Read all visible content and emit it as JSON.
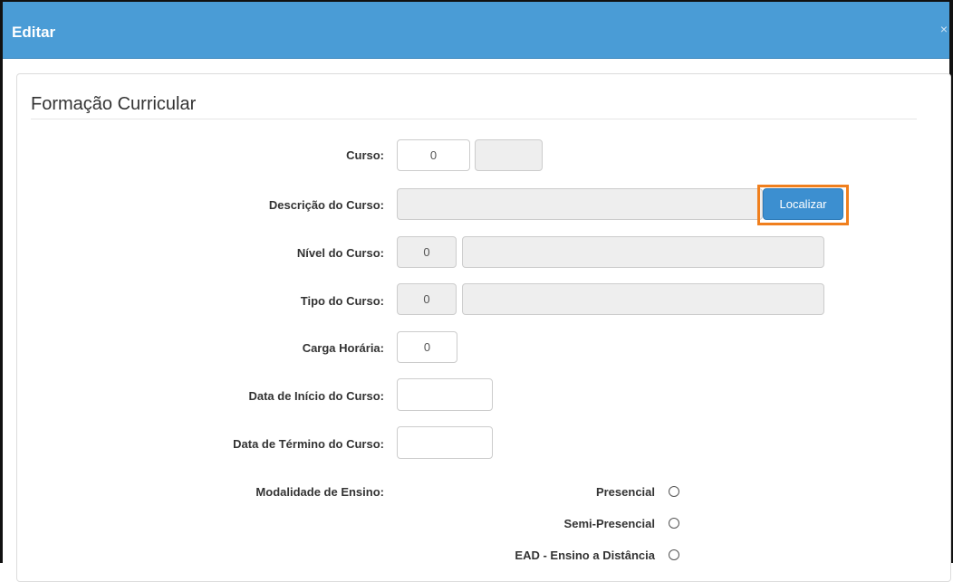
{
  "window": {
    "title": "Editar",
    "close_glyph": "×"
  },
  "section": {
    "title": "Formação Curricular"
  },
  "form": {
    "curso": {
      "label": "Curso:",
      "code_value": "0",
      "name_value": ""
    },
    "descricao": {
      "label": "Descrição do Curso:",
      "value": "",
      "button_label": "Localizar"
    },
    "nivel": {
      "label": "Nível do Curso:",
      "code_value": "0",
      "name_value": ""
    },
    "tipo": {
      "label": "Tipo do Curso:",
      "code_value": "0",
      "name_value": ""
    },
    "carga": {
      "label": "Carga Horária:",
      "value": "0"
    },
    "data_inicio": {
      "label": "Data de Início do Curso:",
      "value": ""
    },
    "data_termino": {
      "label": "Data de Término do Curso:",
      "value": ""
    },
    "modalidade": {
      "label": "Modalidade de Ensino:",
      "options": [
        {
          "label": "Presencial",
          "selected": false
        },
        {
          "label": "Semi-Presencial",
          "selected": false
        },
        {
          "label": "EAD - Ensino a Distância",
          "selected": false
        }
      ]
    }
  },
  "colors": {
    "header": "#4a9cd6",
    "button": "#3c8fd0",
    "highlight": "#f07f1d"
  }
}
